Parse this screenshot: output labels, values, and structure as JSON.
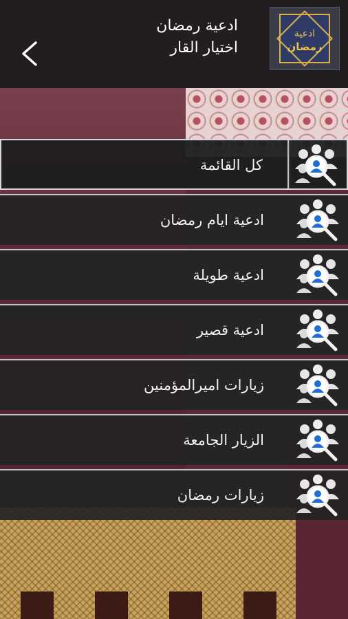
{
  "header": {
    "title_line1": "ادعية رمضان",
    "title_line2": "اختيار القار",
    "logo_text_top": "ادعية",
    "logo_text_bottom": "رمضان"
  },
  "menu": {
    "items": [
      {
        "label": "كل القائمة",
        "selected": true
      },
      {
        "label": "ادعية ايام رمضان",
        "selected": false
      },
      {
        "label": "ادعية طويلة",
        "selected": false
      },
      {
        "label": "ادعية قصير",
        "selected": false
      },
      {
        "label": "زيارات اميرالمؤمنين",
        "selected": false
      },
      {
        "label": "الزيار الجامعة",
        "selected": false
      },
      {
        "label": "زيارات رمضان",
        "selected": false
      }
    ],
    "icon": "people-search-icon"
  },
  "colors": {
    "header_bg": "#221e20",
    "item_bg": "#232325",
    "accent_blue": "#1f6fd1",
    "logo_gold": "#d8b24a"
  }
}
